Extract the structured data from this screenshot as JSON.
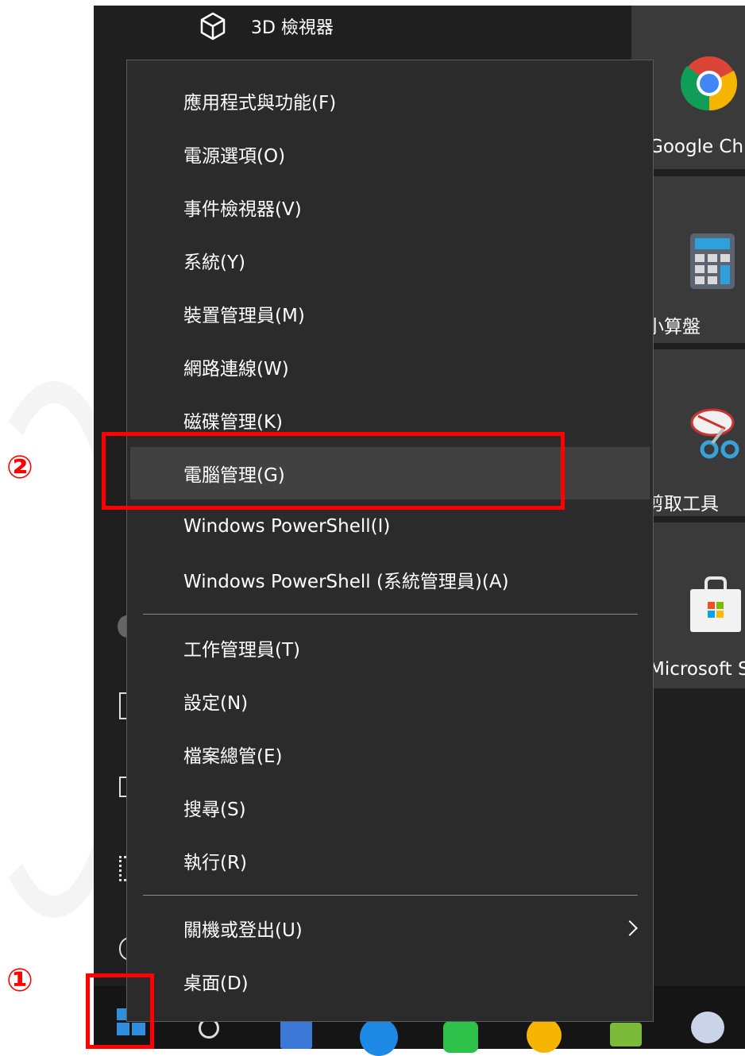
{
  "top_app": {
    "label": "3D 檢視器",
    "icon": "cube-icon"
  },
  "tiles": [
    {
      "label": "Google Chr",
      "icon": "chrome-icon"
    },
    {
      "label": "小算盤",
      "icon": "calculator-icon"
    },
    {
      "label": "剪取工具",
      "icon": "snipping-tool-icon"
    },
    {
      "label": "Microsoft S",
      "icon": "store-icon"
    }
  ],
  "menu": {
    "group1": [
      "應用程式與功能(F)",
      "電源選項(O)",
      "事件檢視器(V)",
      "系統(Y)",
      "裝置管理員(M)",
      "網路連線(W)",
      "磁碟管理(K)",
      "電腦管理(G)",
      "Windows PowerShell(I)",
      "Windows PowerShell (系統管理員)(A)"
    ],
    "group2": [
      "工作管理員(T)",
      "設定(N)",
      "檔案總管(E)",
      "搜尋(S)",
      "執行(R)"
    ],
    "group3": [
      "關機或登出(U)",
      "桌面(D)"
    ],
    "highlighted": "電腦管理(G)"
  },
  "annotations": {
    "step1": "①",
    "step2": "②"
  },
  "colors": {
    "accent": "#ff0000",
    "menu_bg": "#2b2b2b",
    "highlight": "#414141"
  }
}
